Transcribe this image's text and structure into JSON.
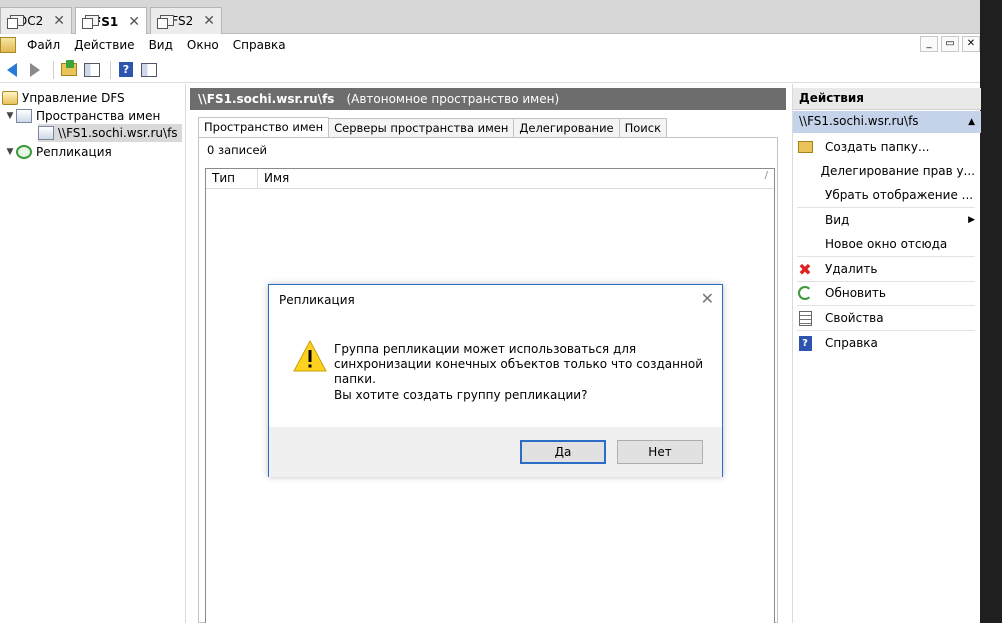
{
  "vm_tabs": [
    {
      "label": "DC2",
      "active": false
    },
    {
      "label": "FS1",
      "active": true
    },
    {
      "label": "FS2",
      "active": false
    }
  ],
  "menu": [
    "Файл",
    "Действие",
    "Вид",
    "Окно",
    "Справка"
  ],
  "window_controls": [
    "_",
    "▭",
    "✕"
  ],
  "tree": {
    "root": "Управление DFS",
    "namespaces": "Пространства имен",
    "namespace_item": "\\\\FS1.sochi.wsr.ru\\fs",
    "replication": "Репликация"
  },
  "middle": {
    "header_path": "\\\\FS1.sochi.wsr.ru\\fs",
    "header_desc": "(Автономное пространство имен)",
    "tabs": [
      "Пространство имен",
      "Серверы пространства имен",
      "Делегирование",
      "Поиск"
    ],
    "count": "0 записей",
    "columns": [
      "Тип",
      "Имя"
    ]
  },
  "actions": {
    "title": "Действия",
    "section": "\\\\FS1.sochi.wsr.ru\\fs",
    "items": [
      {
        "label": "Создать папку...",
        "icon": "new-folder-icon"
      },
      {
        "label": "Делегирование прав у...",
        "icon": ""
      },
      {
        "label": "Убрать отображение ...",
        "icon": ""
      },
      {
        "label": "Вид",
        "icon": "",
        "submenu": true
      },
      {
        "label": "Новое окно отсюда",
        "icon": ""
      },
      {
        "label": "Удалить",
        "icon": "delete-icon"
      },
      {
        "label": "Обновить",
        "icon": "refresh-icon"
      },
      {
        "label": "Свойства",
        "icon": "properties-icon"
      },
      {
        "label": "Справка",
        "icon": "help-icon"
      }
    ]
  },
  "dialog": {
    "title": "Репликация",
    "message": "Группа репликации может использоваться для синхронизации конечных объектов только что созданной папки.",
    "question": "Вы хотите создать группу репликации?",
    "yes": "Да",
    "no": "Нет"
  },
  "colors": {
    "accent": "#2b6cc7",
    "header_gray": "#6d6d6d",
    "actions_section": "#c5d3ea"
  }
}
